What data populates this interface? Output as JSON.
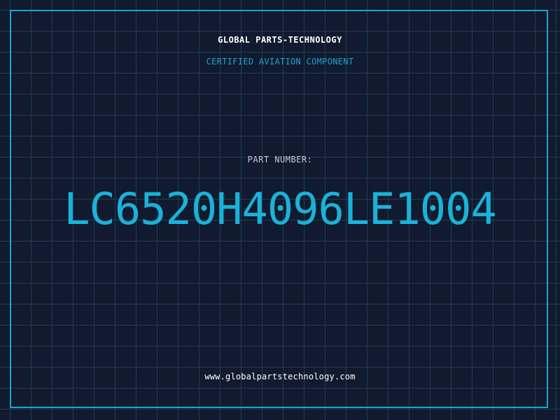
{
  "header": {
    "brand": "GLOBAL PARTS-TECHNOLOGY",
    "tagline": "CERTIFIED AVIATION COMPONENT"
  },
  "part": {
    "label": "PART NUMBER:",
    "number": "LC6520H4096LE1004"
  },
  "footer": {
    "url": "www.globalpartstechnology.com"
  },
  "colors": {
    "background": "#111a2e",
    "grid": "#1f3f5c",
    "accent": "#1aa6cf",
    "text": "#ffffff",
    "label": "#c2cad6"
  }
}
